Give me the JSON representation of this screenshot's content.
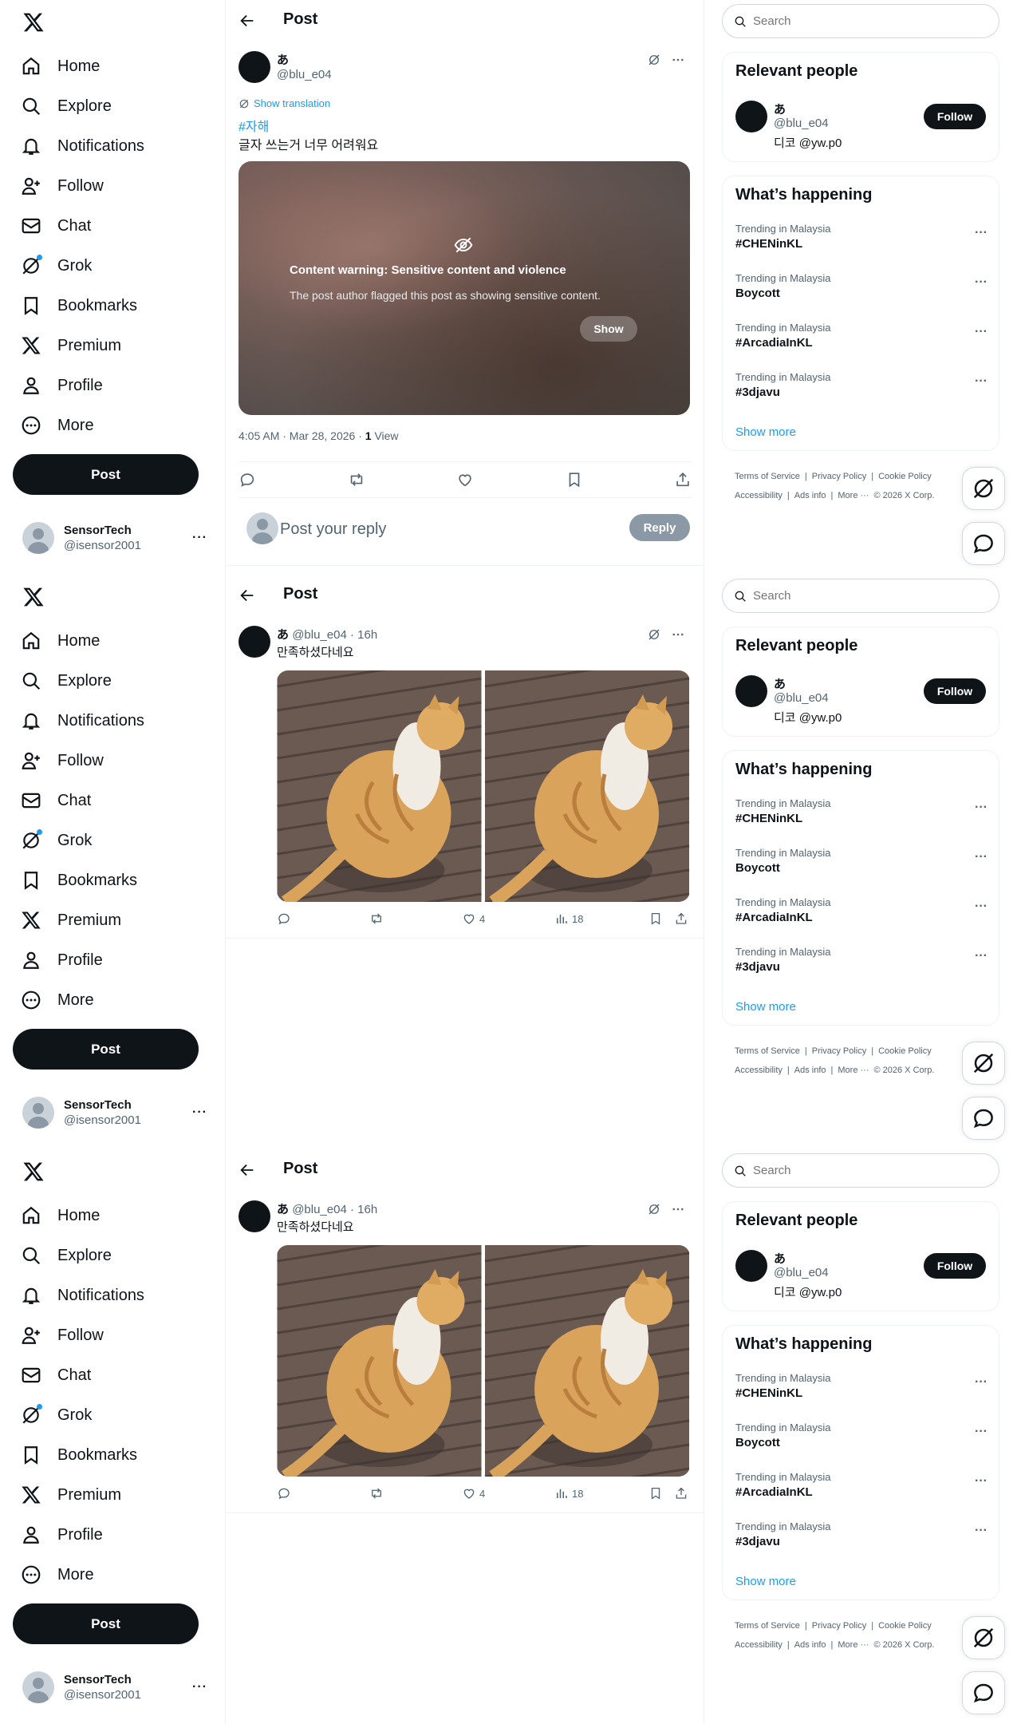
{
  "left": {
    "nav": [
      {
        "label": "Home",
        "icon": "home-icon"
      },
      {
        "label": "Explore",
        "icon": "search-icon"
      },
      {
        "label": "Notifications",
        "icon": "bell-icon"
      },
      {
        "label": "Follow",
        "icon": "follow-icon"
      },
      {
        "label": "Chat",
        "icon": "mail-icon"
      },
      {
        "label": "Grok",
        "icon": "grok-icon"
      },
      {
        "label": "Bookmarks",
        "icon": "bookmark-icon"
      },
      {
        "label": "Premium",
        "icon": "x-icon"
      },
      {
        "label": "Profile",
        "icon": "person-icon"
      },
      {
        "label": "More",
        "icon": "more-circle-icon"
      }
    ],
    "post_button": "Post",
    "account": {
      "name": "SensorTech",
      "handle": "@isensor2001",
      "more": "···"
    }
  },
  "center": {
    "header_title": "Post",
    "main_post": {
      "author_name": "あ",
      "author_handle": "@blu_e04",
      "show_translation": "Show translation",
      "hashtag": "#자해",
      "text": "글자 쓰는거 너무 어려워요",
      "warning_title": "Content warning: Sensitive content and violence",
      "warning_body": "The post author flagged this post as showing sensitive content.",
      "warning_show": "Show",
      "time": "4:05 AM · Mar 28, 2026 · ",
      "views_count": "1",
      "views_label": "View",
      "reply_placeholder": "Post your reply",
      "reply_button": "Reply"
    },
    "cat_post": {
      "author_name": "あ",
      "author_handle": "@blu_e04 · 16h",
      "text": "만족하셨다네요",
      "likes": "4",
      "views": "18"
    }
  },
  "right": {
    "search_placeholder": "Search",
    "relevant_title": "Relevant people",
    "person": {
      "name": "あ",
      "handle": "@blu_e04",
      "bio": "디코 @yw.p0",
      "follow": "Follow"
    },
    "happening_title": "What’s happening",
    "trends": [
      {
        "context": "Trending in Malaysia",
        "name": "#CHENinKL"
      },
      {
        "context": "Trending in Malaysia",
        "name": "Boycott"
      },
      {
        "context": "Trending in Malaysia",
        "name": "#ArcadiaInKL"
      },
      {
        "context": "Trending in Malaysia",
        "name": "#3djavu"
      }
    ],
    "show_more": "Show more",
    "footer_row1": [
      "Terms of Service",
      "|",
      "Privacy Policy",
      "|",
      "Cookie Policy"
    ],
    "footer_row2": [
      "Accessibility",
      "|",
      "Ads info",
      "|",
      "More ···",
      "© 2026 X Corp."
    ]
  },
  "colors": {
    "accent": "#1d9bf0",
    "text": "#0f1419",
    "muted": "#536471",
    "border": "#eff3f4"
  }
}
